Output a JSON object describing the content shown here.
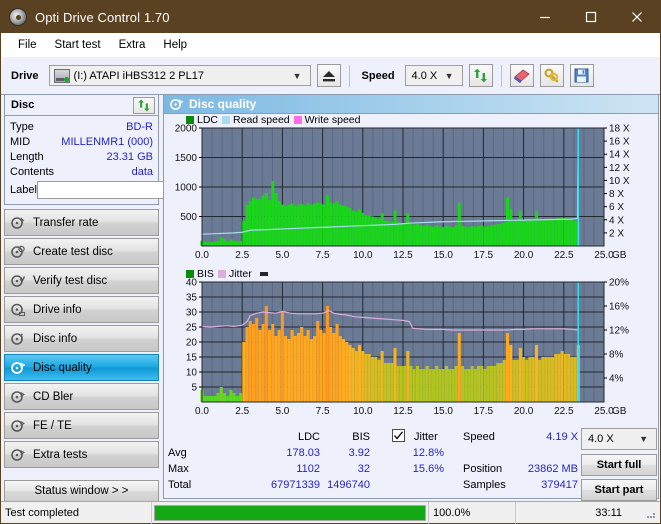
{
  "window": {
    "title": "Opti Drive Control 1.70",
    "app_icon": "disc-icon",
    "minimize": "–",
    "maximize": "□",
    "close": "×"
  },
  "menu": [
    {
      "label": "File"
    },
    {
      "label": "Start test"
    },
    {
      "label": "Extra"
    },
    {
      "label": "Help"
    }
  ],
  "toolbar": {
    "drive_label": "Drive",
    "drive_value": "(I:)  ATAPI iHBS312  2 PL17",
    "eject_icon": "eject-icon",
    "speed_label": "Speed",
    "speed_value": "4.0 X",
    "refresh_icon": "refresh-icon",
    "erase_icon": "eraser-icon",
    "tools_icon": "tools-icon",
    "save_icon": "save-icon"
  },
  "disc": {
    "title": "Disc",
    "refresh_icon": "refresh-icon",
    "rows": [
      {
        "key": "Type",
        "value": "BD-R"
      },
      {
        "key": "MID",
        "value": "MILLENMR1 (000)"
      },
      {
        "key": "Length",
        "value": "23.31 GB"
      },
      {
        "key": "Contents",
        "value": "data"
      }
    ],
    "label_key": "Label",
    "label_value": "",
    "label_placeholder": "",
    "label_icon": "disc-icon"
  },
  "nav": {
    "items": [
      {
        "label": "Transfer rate",
        "icon": "disc-rate-icon",
        "active": false
      },
      {
        "label": "Create test disc",
        "icon": "disc-create-icon",
        "active": false
      },
      {
        "label": "Verify test disc",
        "icon": "disc-verify-icon",
        "active": false
      },
      {
        "label": "Drive info",
        "icon": "disc-drive-icon",
        "active": false
      },
      {
        "label": "Disc info",
        "icon": "disc-info-icon",
        "active": false
      },
      {
        "label": "Disc quality",
        "icon": "disc-quality-icon",
        "active": true
      },
      {
        "label": "CD Bler",
        "icon": "disc-bler-icon",
        "active": false
      },
      {
        "label": "FE / TE",
        "icon": "disc-fete-icon",
        "active": false
      },
      {
        "label": "Extra tests",
        "icon": "disc-extra-icon",
        "active": false
      }
    ],
    "status_window": "Status window > >"
  },
  "panel": {
    "title": "Disc quality",
    "icon": "disc-quality-icon"
  },
  "stats": {
    "col_ldc": "LDC",
    "col_bis": "BIS",
    "jitter_label": "Jitter",
    "jitter_checked": true,
    "row_avg": "Avg",
    "row_max": "Max",
    "row_total": "Total",
    "avg_ldc": "178.03",
    "avg_bis": "3.92",
    "avg_jitter": "12.8%",
    "max_ldc": "1102",
    "max_bis": "32",
    "max_jitter": "15.6%",
    "total_ldc": "67971339",
    "total_bis": "1496740",
    "speed_label": "Speed",
    "speed_value": "4.19 X",
    "position_label": "Position",
    "position_value": "23862 MB",
    "samples_label": "Samples",
    "samples_value": "379417",
    "speed_select": "4.0 X",
    "start_full": "Start full",
    "start_part": "Start part"
  },
  "statusbar": {
    "message": "Test completed",
    "percent_text": "100.0%",
    "percent_value": 100,
    "elapsed": "33:11",
    "grip_icon": "resize-grip-icon"
  },
  "colors": {
    "title_bar": "#5a4121",
    "accent": "#19a9e4",
    "value_blue": "#2424c8",
    "plot_bg": "#6b7a95",
    "ldc_green": "#18d618",
    "read_speed": "#a8e2f5",
    "write_speed": "#ff6ee0",
    "jitter_pink": "#dcaede",
    "progress_green": "#16a916",
    "cursor_cyan": "#35dff5"
  },
  "chart_data": [
    {
      "type": "area",
      "id": "ldc-chart",
      "title": "",
      "legend": [
        {
          "label": "LDC",
          "color": "#0a8a0a"
        },
        {
          "label": "Read speed",
          "color": "#a8dcf0"
        },
        {
          "label": "Write speed",
          "color": "#ff6ee0"
        }
      ],
      "legend_position": "top-left",
      "xlabel": "GB",
      "ylabel": "",
      "xlim": [
        0.0,
        25.0
      ],
      "xticks": [
        0.0,
        2.5,
        5.0,
        7.5,
        10.0,
        12.5,
        15.0,
        17.5,
        20.0,
        22.5,
        25.0
      ],
      "xticklabels": [
        "0.0",
        "2.5",
        "5.0",
        "7.5",
        "10.0",
        "12.5",
        "15.0",
        "17.5",
        "20.0",
        "22.5",
        "25.0"
      ],
      "ylim": [
        0,
        2000
      ],
      "yticks": [
        500,
        1000,
        1500,
        2000
      ],
      "yticklabels": [
        "500",
        "1000",
        "1500",
        "2000"
      ],
      "y2lim": [
        0,
        18
      ],
      "y2ticks": [
        2,
        4,
        6,
        8,
        10,
        12,
        14,
        16,
        18
      ],
      "y2ticklabels": [
        "2 X",
        "4 X",
        "6 X",
        "8 X",
        "10 X",
        "12 X",
        "14 X",
        "16 X",
        "18 X"
      ],
      "grid": true,
      "cursor_x": 23.4,
      "series": [
        {
          "name": "LDC",
          "color": "#18d618",
          "kind": "bars",
          "x": [
            0.0,
            0.2,
            0.4,
            0.6,
            0.8,
            1.0,
            1.2,
            1.4,
            1.6,
            1.8,
            2.0,
            2.2,
            2.4,
            2.6,
            2.8,
            3.0,
            3.2,
            3.4,
            3.6,
            3.8,
            4.0,
            4.2,
            4.4,
            4.6,
            4.8,
            5.0,
            5.2,
            5.4,
            5.6,
            5.8,
            6.0,
            6.2,
            6.4,
            6.6,
            6.8,
            7.0,
            7.2,
            7.4,
            7.6,
            7.8,
            8.0,
            8.2,
            8.4,
            8.6,
            8.8,
            9.0,
            9.2,
            9.4,
            9.6,
            9.8,
            10.0,
            10.2,
            10.4,
            10.6,
            10.8,
            11.0,
            11.2,
            11.4,
            11.6,
            11.8,
            12.0,
            12.2,
            12.4,
            12.6,
            12.8,
            13.0,
            13.2,
            13.4,
            13.6,
            13.8,
            14.0,
            14.2,
            14.4,
            14.6,
            14.8,
            15.0,
            15.2,
            15.4,
            15.6,
            15.8,
            16.0,
            16.2,
            16.4,
            16.6,
            16.8,
            17.0,
            17.2,
            17.4,
            17.6,
            17.8,
            18.0,
            18.2,
            18.4,
            18.6,
            18.8,
            19.0,
            19.2,
            19.4,
            19.6,
            19.8,
            20.0,
            20.2,
            20.4,
            20.6,
            20.8,
            21.0,
            21.2,
            21.4,
            21.6,
            21.8,
            22.0,
            22.2,
            22.4,
            22.6,
            22.8,
            23.0,
            23.2,
            23.4
          ],
          "values": [
            90,
            70,
            60,
            65,
            70,
            85,
            150,
            120,
            70,
            110,
            90,
            75,
            85,
            430,
            700,
            760,
            820,
            800,
            790,
            860,
            900,
            780,
            1102,
            900,
            760,
            700,
            690,
            700,
            720,
            680,
            700,
            710,
            690,
            730,
            700,
            720,
            740,
            720,
            700,
            860,
            740,
            720,
            760,
            700,
            690,
            670,
            640,
            600,
            580,
            620,
            560,
            520,
            520,
            500,
            480,
            460,
            560,
            430,
            420,
            410,
            600,
            400,
            390,
            380,
            560,
            370,
            360,
            370,
            350,
            340,
            360,
            340,
            330,
            350,
            330,
            320,
            340,
            330,
            320,
            350,
            730,
            340,
            330,
            320,
            340,
            330,
            340,
            350,
            330,
            340,
            350,
            360,
            370,
            380,
            400,
            820,
            620,
            420,
            430,
            600,
            440,
            430,
            450,
            440,
            600,
            430,
            440,
            450,
            440,
            450,
            460,
            470,
            480,
            470,
            460,
            450,
            430,
            420
          ]
        },
        {
          "name": "Read speed",
          "color": "#a8dcf0",
          "kind": "line",
          "x": [
            0.0,
            1.0,
            2.0,
            2.5,
            3.0,
            4.0,
            5.0,
            6.0,
            7.0,
            8.0,
            9.0,
            10.0,
            11.0,
            12.0,
            13.0,
            14.0,
            15.0,
            16.0,
            17.0,
            18.0,
            19.0,
            20.0,
            21.0,
            22.0,
            23.0,
            23.35,
            23.4
          ],
          "values": [
            1.8,
            1.9,
            2.0,
            2.1,
            2.4,
            2.5,
            2.6,
            2.7,
            2.8,
            2.9,
            3.0,
            3.1,
            3.2,
            3.3,
            3.5,
            3.6,
            3.7,
            3.75,
            3.8,
            3.85,
            3.9,
            3.95,
            4.0,
            4.05,
            4.1,
            4.2,
            18.0
          ],
          "axis": "y2"
        },
        {
          "name": "Write speed",
          "color": "#ff6ee0",
          "kind": "line",
          "x": [],
          "values": [],
          "axis": "y2"
        }
      ]
    },
    {
      "type": "area",
      "id": "bis-jitter-chart",
      "title": "",
      "legend": [
        {
          "label": "BIS",
          "color": "#0a8a0a"
        },
        {
          "label": "Jitter",
          "color": "#dcaede"
        },
        {
          "label": "",
          "color": "#23282f"
        }
      ],
      "legend_position": "top-left",
      "xlabel": "GB",
      "ylabel": "",
      "xlim": [
        0.0,
        25.0
      ],
      "xticks": [
        0.0,
        2.5,
        5.0,
        7.5,
        10.0,
        12.5,
        15.0,
        17.5,
        20.0,
        22.5,
        25.0
      ],
      "xticklabels": [
        "0.0",
        "2.5",
        "5.0",
        "7.5",
        "10.0",
        "12.5",
        "15.0",
        "17.5",
        "20.0",
        "22.5",
        "25.0"
      ],
      "ylim": [
        0,
        40
      ],
      "yticks": [
        5,
        10,
        15,
        20,
        25,
        30,
        35,
        40
      ],
      "yticklabels": [
        "5",
        "10",
        "15",
        "20",
        "25",
        "30",
        "35",
        "40"
      ],
      "y2lim": [
        0,
        20
      ],
      "y2ticks": [
        4,
        8,
        12,
        16,
        20
      ],
      "y2ticklabels": [
        "4%",
        "8%",
        "12%",
        "16%",
        "20%"
      ],
      "grid": true,
      "cursor_x": 23.4,
      "series": [
        {
          "name": "BIS",
          "color": "#2ee02e",
          "kind": "bars",
          "x": [
            0.0,
            0.2,
            0.4,
            0.6,
            0.8,
            1.0,
            1.2,
            1.4,
            1.6,
            1.8,
            2.0,
            2.2,
            2.4,
            2.6,
            2.8,
            3.0,
            3.2,
            3.4,
            3.6,
            3.8,
            4.0,
            4.2,
            4.4,
            4.6,
            4.8,
            5.0,
            5.2,
            5.4,
            5.6,
            5.8,
            6.0,
            6.2,
            6.4,
            6.6,
            6.8,
            7.0,
            7.2,
            7.4,
            7.6,
            7.8,
            8.0,
            8.2,
            8.4,
            8.6,
            8.8,
            9.0,
            9.2,
            9.4,
            9.6,
            9.8,
            10.0,
            10.2,
            10.4,
            10.6,
            10.8,
            11.0,
            11.2,
            11.4,
            11.6,
            11.8,
            12.0,
            12.2,
            12.4,
            12.6,
            12.8,
            13.0,
            13.2,
            13.4,
            13.6,
            13.8,
            14.0,
            14.2,
            14.4,
            14.6,
            14.8,
            15.0,
            15.2,
            15.4,
            15.6,
            15.8,
            16.0,
            16.2,
            16.4,
            16.6,
            16.8,
            17.0,
            17.2,
            17.4,
            17.6,
            17.8,
            18.0,
            18.2,
            18.4,
            18.6,
            18.8,
            19.0,
            19.2,
            19.4,
            19.6,
            19.8,
            20.0,
            20.2,
            20.4,
            20.6,
            20.8,
            21.0,
            21.2,
            21.4,
            21.6,
            21.8,
            22.0,
            22.2,
            22.4,
            22.6,
            22.8,
            23.0,
            23.2,
            23.4
          ],
          "values": [
            4,
            2,
            2,
            2,
            2,
            3,
            5,
            3,
            2,
            4,
            3,
            2,
            3,
            20,
            25,
            27,
            26,
            28,
            24,
            26,
            32,
            24,
            26,
            22,
            24,
            30,
            22,
            21,
            24,
            22,
            23,
            25,
            22,
            24,
            21,
            22,
            27,
            24,
            23,
            32,
            25,
            23,
            26,
            22,
            21,
            20,
            19,
            18,
            17,
            19,
            17,
            16,
            16,
            15,
            15,
            14,
            17,
            13,
            13,
            13,
            18,
            12,
            12,
            12,
            17,
            12,
            11,
            12,
            11,
            11,
            12,
            11,
            11,
            12,
            11,
            11,
            12,
            11,
            11,
            12,
            23,
            12,
            11,
            11,
            12,
            11,
            12,
            12,
            11,
            12,
            12,
            12,
            13,
            13,
            14,
            23,
            19,
            14,
            14,
            18,
            15,
            14,
            15,
            15,
            19,
            14,
            15,
            15,
            15,
            15,
            16,
            16,
            17,
            16,
            16,
            15,
            15,
            19
          ]
        },
        {
          "name": "Jitter",
          "color": "#dcaede",
          "kind": "line",
          "x": [
            0.0,
            0.5,
            1.0,
            1.5,
            2.0,
            2.5,
            2.8,
            3.0,
            3.4,
            3.8,
            4.2,
            4.6,
            5.0,
            5.5,
            6.0,
            6.5,
            7.0,
            7.5,
            7.9,
            8.2,
            8.6,
            9.0,
            9.5,
            10.0,
            10.5,
            11.0,
            11.5,
            12.0,
            12.5,
            12.9,
            13.1,
            13.5,
            14.0,
            14.5,
            15.0,
            15.5,
            16.0,
            16.5,
            17.0,
            17.5,
            18.0,
            18.5,
            19.0,
            19.5,
            20.0,
            20.5,
            21.0,
            21.5,
            22.0,
            22.5,
            23.0,
            23.4
          ],
          "values": [
            12.6,
            12.5,
            12.6,
            12.7,
            12.6,
            12.8,
            13.4,
            14.4,
            14.8,
            15.0,
            14.9,
            14.8,
            15.1,
            14.8,
            14.7,
            14.7,
            14.7,
            14.8,
            15.2,
            14.8,
            14.6,
            14.5,
            14.2,
            14.1,
            14.0,
            13.9,
            13.8,
            13.7,
            13.6,
            13.4,
            12.3,
            12.2,
            12.1,
            12.1,
            12.1,
            12.0,
            12.0,
            12.0,
            12.0,
            12.0,
            12.0,
            12.0,
            12.0,
            12.1,
            12.1,
            12.2,
            12.2,
            12.2,
            12.2,
            12.2,
            12.1,
            12.0
          ],
          "axis": "y2"
        }
      ]
    }
  ]
}
